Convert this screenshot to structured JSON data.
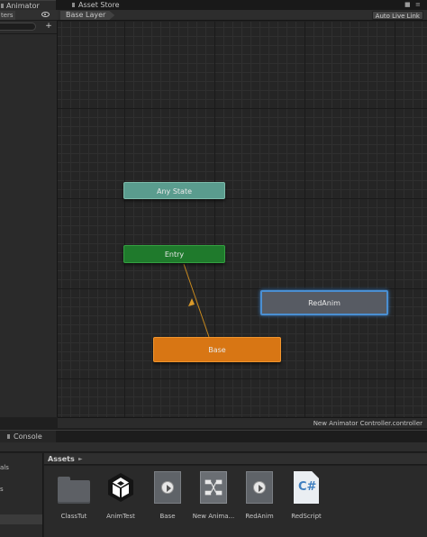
{
  "window_tabs": {
    "animator": "Animator",
    "asset_store": "Asset Store"
  },
  "left_panel": {
    "params_tab": "ters"
  },
  "graph": {
    "breadcrumb": "Base Layer",
    "live_link_button": "Auto Live Link",
    "nodes": {
      "any_state": "Any State",
      "entry": "Entry",
      "red_anim": "RedAnim",
      "base": "Base"
    },
    "footer_path": "New Animator Controller.controller"
  },
  "console": {
    "tab": "Console"
  },
  "project": {
    "tree_items": [
      "als",
      "s"
    ],
    "breadcrumb": "Assets",
    "assets": [
      {
        "label": "ClassTut",
        "icon": "folder-icon"
      },
      {
        "label": "AnimTest",
        "icon": "unity-icon"
      },
      {
        "label": "Base",
        "icon": "animation-clip-icon"
      },
      {
        "label": "New Anima...",
        "icon": "animator-controller-icon"
      },
      {
        "label": "RedAnim",
        "icon": "animation-clip-icon"
      },
      {
        "label": "RedScript",
        "icon": "csharp-script-icon"
      }
    ]
  },
  "colors": {
    "any_state": "#5a9c8e",
    "entry": "#1f7a2c",
    "default_state": "#d87614",
    "selected_outline": "#4a8fd2",
    "transition": "#c98a1e"
  }
}
